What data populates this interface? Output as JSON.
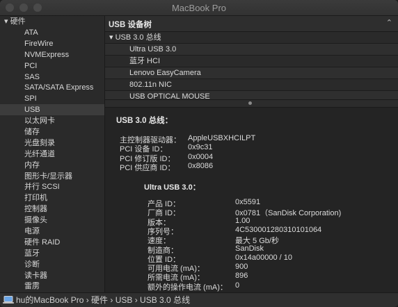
{
  "window": {
    "title": "MacBook Pro"
  },
  "sidebar": {
    "group": "▾ 硬件",
    "items": [
      "ATA",
      "FireWire",
      "NVMExpress",
      "PCI",
      "SAS",
      "SATA/SATA Express",
      "SPI",
      "USB",
      "以太网卡",
      "储存",
      "光盘刻录",
      "光纤通道",
      "内存",
      "图形卡/显示器",
      "并行 SCSI",
      "打印机",
      "控制器",
      "摄像头",
      "电源",
      "硬件 RAID",
      "蓝牙",
      "诊断",
      "读卡器",
      "雷雳"
    ],
    "selected": "USB"
  },
  "tree": {
    "header": "USB 设备树",
    "chevron": "⌃",
    "root": "▾ USB 3.0 总线",
    "children": [
      "Ultra USB 3.0",
      "蓝牙 HCI",
      "Lenovo EasyCamera",
      "802.11n NIC",
      "USB OPTICAL MOUSE"
    ]
  },
  "detail": {
    "title": "USB 3.0 总线：",
    "bus_props": [
      {
        "k": "主控制器驱动器：",
        "v": "AppleUSBXHCILPT"
      },
      {
        "k": "PCI 设备 ID：",
        "v": "0x9c31"
      },
      {
        "k": "PCI 修订版 ID：",
        "v": "0x0004"
      },
      {
        "k": "PCI 供应商 ID：",
        "v": "0x8086"
      }
    ],
    "device_title": "Ultra USB 3.0：",
    "device_props": [
      {
        "k": "产品 ID：",
        "v": "0x5591"
      },
      {
        "k": "厂商 ID：",
        "v": "0x0781（SanDisk Corporation)"
      },
      {
        "k": "版本：",
        "v": "1.00"
      },
      {
        "k": "序列号：",
        "v": "4C530001280310101064"
      },
      {
        "k": "速度：",
        "v": "最大 5 Gb/秒"
      },
      {
        "k": "制造商：",
        "v": "SanDisk"
      },
      {
        "k": "位置 ID：",
        "v": "0x14a00000 / 10"
      },
      {
        "k": "可用电流 (mA)：",
        "v": "900"
      },
      {
        "k": "所需电流 (mA)：",
        "v": "896"
      },
      {
        "k": "额外的操作电流 (mA)：",
        "v": "0"
      }
    ]
  },
  "statusbar": {
    "path": "hu的MacBook Pro › 硬件 › USB › USB 3.0 总线",
    "icon": "laptop-icon"
  }
}
